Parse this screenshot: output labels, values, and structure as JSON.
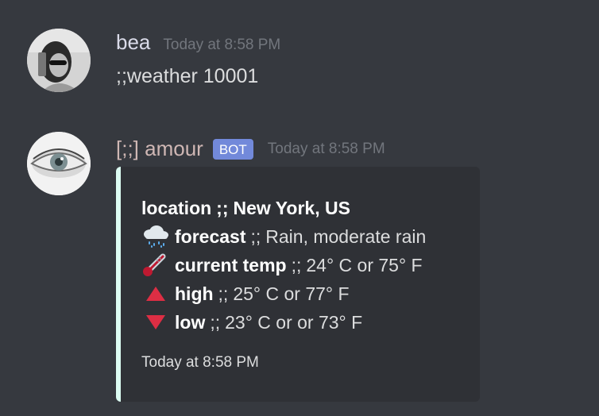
{
  "messages": [
    {
      "username": "bea",
      "timestamp": "Today at 8:58 PM",
      "content": ";;weather 10001"
    },
    {
      "username": "[;;] amour",
      "bot_tag": "BOT",
      "timestamp": "Today at 8:58 PM",
      "embed": {
        "accent_color": "#dcfcf2",
        "title_label": "location",
        "title_sep": ";;",
        "title_value": "New York, US",
        "fields": [
          {
            "icon": "rain-cloud-icon",
            "label": "forecast",
            "sep": ";;",
            "value": "Rain, moderate rain"
          },
          {
            "icon": "thermometer-icon",
            "label": "current temp",
            "sep": ";;",
            "value": "24° C or 75° F"
          },
          {
            "icon": "up-triangle-icon",
            "label": "high",
            "sep": ";;",
            "value": "25° C or 77° F"
          },
          {
            "icon": "down-triangle-icon",
            "label": "low",
            "sep": ";;",
            "value": "23° C or or 73° F"
          }
        ],
        "footer": "Today at 8:58 PM"
      }
    }
  ],
  "colors": {
    "background": "#36393f",
    "embed_background": "#2f3136",
    "bot_tag": "#7289da",
    "timestamp": "#72767d",
    "triangle": "#dd2e44"
  }
}
